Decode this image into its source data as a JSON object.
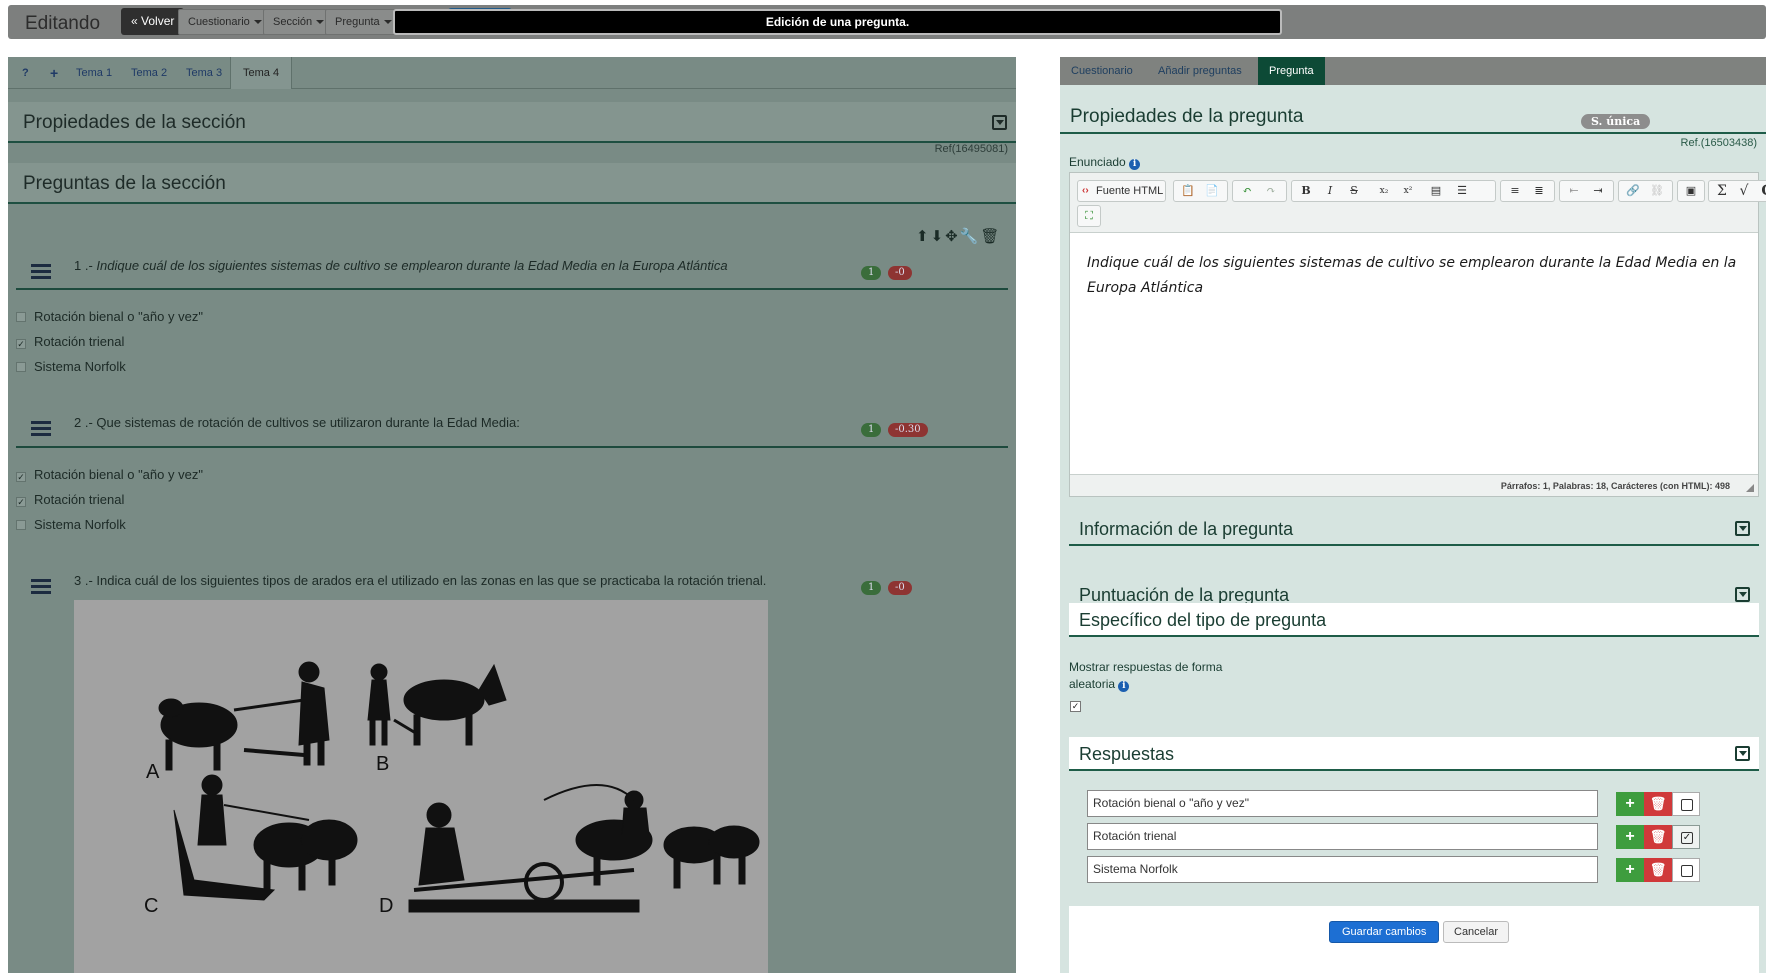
{
  "topbar": {
    "brand": "Editando",
    "back": "« Volver",
    "menus": [
      "Cuestionario",
      "Sección",
      "Pregunta"
    ],
    "toast": "Edición de una pregunta."
  },
  "left": {
    "tabs": [
      "Tema 1",
      "Tema 2",
      "Tema 3",
      "Tema 4"
    ],
    "section_props_title": "Propiedades de la sección",
    "section_ref": "Ref(16495081)",
    "section_questions_title": "Preguntas de la sección",
    "questions": [
      {
        "number": "1 .-",
        "text": "Indique cuál de los siguientes sistemas de cultivo se emplearon durante la Edad Media en la Europa Atlántica",
        "score_pos": "1",
        "score_neg": "-0",
        "options": [
          "Rotación bienal o \"año y vez\"",
          "Rotación trienal",
          "Sistema Norfolk"
        ],
        "checked": [
          false,
          true,
          false
        ]
      },
      {
        "number": "2 .-",
        "text": "Que sistemas de rotación de cultivos se utilizaron durante la Edad Media:",
        "score_pos": "1",
        "score_neg": "-0.30",
        "options": [
          "Rotación bienal o \"año y vez\"",
          "Rotación trienal",
          "Sistema Norfolk"
        ],
        "checked": [
          true,
          true,
          false
        ]
      },
      {
        "number": "3 .-",
        "text": "Indica cuál de los siguientes tipos de arados era el utilizado en las zonas en las que se practicaba la rotación trienal.",
        "score_pos": "1",
        "score_neg": "-0",
        "image_labels": [
          "A",
          "B",
          "C",
          "D"
        ]
      }
    ]
  },
  "right": {
    "tabs": [
      "Cuestionario",
      "Añadir preguntas",
      "Pregunta"
    ],
    "props_title": "Propiedades de la pregunta",
    "type_badge": "S. única",
    "ref": "Ref.(16503438)",
    "enunciado_label": "Enunciado",
    "editor": {
      "source_button": "Fuente HTML",
      "content": "Indique cuál de los siguientes sistemas de cultivo se emplearon durante la Edad Media en la Europa Atlántica",
      "status": "Párrafos: 1, Palabras: 18, Carácteres (con HTML): 498"
    },
    "info_title": "Información de la pregunta",
    "score_title": "Puntuación de la pregunta",
    "specific_title": "Específico del tipo de pregunta",
    "random_label": "Mostrar respuestas de forma aleatoria",
    "answers_title": "Respuestas",
    "answers": [
      {
        "text": "Rotación bienal o \"año y vez\"",
        "correct": false
      },
      {
        "text": "Rotación trienal",
        "correct": true
      },
      {
        "text": "Sistema Norfolk",
        "correct": false
      }
    ],
    "save": "Guardar cambios",
    "cancel": "Cancelar"
  }
}
